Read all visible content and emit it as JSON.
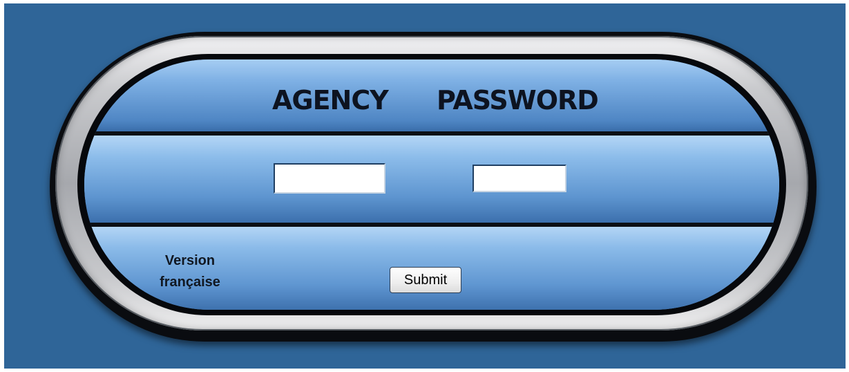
{
  "form": {
    "agency_label": "AGENCY",
    "password_label": "PASSWORD",
    "agency_value": "",
    "password_value": "",
    "language_link_line1": "Version",
    "language_link_line2": "française",
    "submit_label": "Submit"
  },
  "colors": {
    "page_background": "#2f6598",
    "panel_blue": "#5e95d0",
    "ring_silver": "#b0b2b6"
  }
}
